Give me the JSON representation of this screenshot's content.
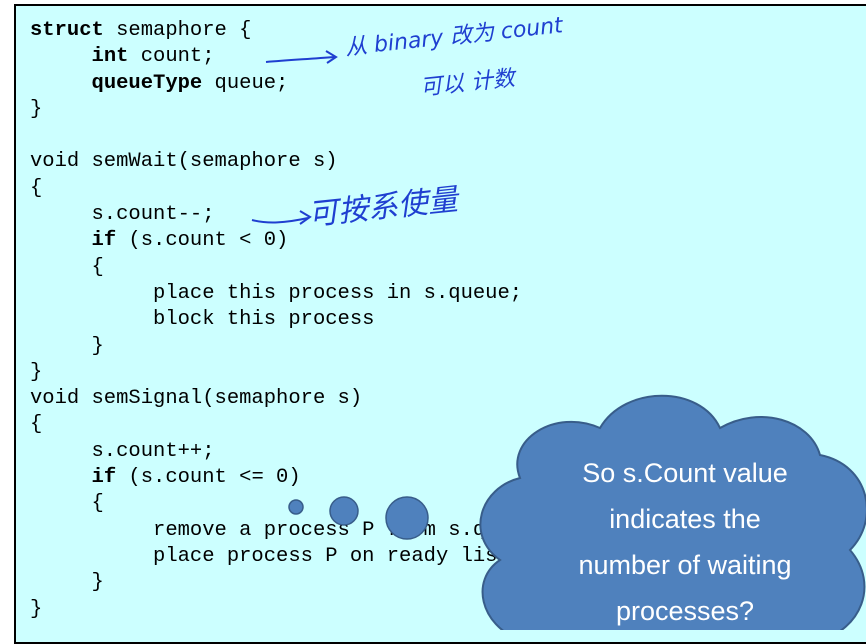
{
  "code_lines": [
    [
      {
        "t": "struct",
        "b": true
      },
      {
        "t": " semaphore {"
      }
    ],
    [
      {
        "t": "     "
      },
      {
        "t": "int",
        "b": true
      },
      {
        "t": " count;"
      }
    ],
    [
      {
        "t": "     "
      },
      {
        "t": "queueType",
        "b": true
      },
      {
        "t": " queue;"
      }
    ],
    [
      {
        "t": "}"
      }
    ],
    [
      {
        "t": ""
      }
    ],
    [
      {
        "t": "void semWait(semaphore s)"
      }
    ],
    [
      {
        "t": "{"
      }
    ],
    [
      {
        "t": "     s.count--;"
      }
    ],
    [
      {
        "t": "     "
      },
      {
        "t": "if",
        "b": true
      },
      {
        "t": " (s.count < 0)"
      }
    ],
    [
      {
        "t": "     {"
      }
    ],
    [
      {
        "t": "          place this process in s.queue;"
      }
    ],
    [
      {
        "t": "          block this process"
      }
    ],
    [
      {
        "t": "     }"
      }
    ],
    [
      {
        "t": "}"
      }
    ],
    [
      {
        "t": "void semSignal(semaphore s)"
      }
    ],
    [
      {
        "t": "{"
      }
    ],
    [
      {
        "t": "     s.count++;"
      }
    ],
    [
      {
        "t": "     "
      },
      {
        "t": "if",
        "b": true
      },
      {
        "t": " (s.count <= 0)"
      }
    ],
    [
      {
        "t": "     {"
      }
    ],
    [
      {
        "t": "          remove a process P from s.queue;"
      }
    ],
    [
      {
        "t": "          place process P on ready list;"
      }
    ],
    [
      {
        "t": "     }"
      }
    ],
    [
      {
        "t": "}"
      }
    ]
  ],
  "annotations": {
    "count_note_line1": "从 binary 改为 count",
    "count_note_line2": "可以 计数",
    "decrement_note": "可按系使量"
  },
  "callout": {
    "lines": [
      "So s.Count value",
      "indicates the",
      "number of waiting",
      "processes?"
    ]
  },
  "colors": {
    "panel_bg": "#ccffff",
    "ink": "#1f3fd0",
    "cloud_fill": "#4f81bd",
    "cloud_stroke": "#385d8a",
    "cloud_text": "#ffffff"
  }
}
